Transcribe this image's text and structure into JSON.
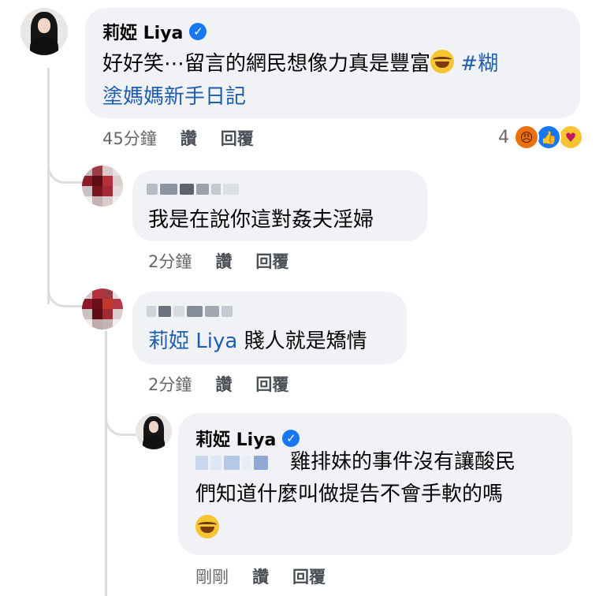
{
  "comments": [
    {
      "author": "莉婭 Liya",
      "verified": true,
      "text_line1": "好好笑⋯留言的網民想像力真是豐富",
      "hashtag_part1": "#糊",
      "text_line2": "塗媽媽新手日記",
      "time": "45分鐘",
      "like_label": "讚",
      "reply_label": "回覆",
      "reaction_count": "4"
    },
    {
      "author_blurred": true,
      "text": "我是在說你這對姦夫淫婦",
      "time": "2分鐘",
      "like_label": "讚",
      "reply_label": "回覆"
    },
    {
      "author_blurred": true,
      "mention": "莉婭 Liya",
      "text": "賤人就是矯情",
      "time": "2分鐘",
      "like_label": "讚",
      "reply_label": "回覆"
    },
    {
      "author": "莉婭 Liya",
      "verified": true,
      "text_line1": "雞排妹的事件沒有讓酸民",
      "text_line2": "們知道什麼叫做提告不會手軟的嗎",
      "time": "剛剛",
      "like_label": "讚",
      "reply_label": "回覆"
    }
  ],
  "icons": {
    "verified": "verified-badge-icon",
    "reaction_angry": "angry-reaction-icon",
    "reaction_like": "like-reaction-icon",
    "reaction_care": "care-reaction-icon",
    "emoji": "laughing-tears-emoji"
  },
  "colors": {
    "bubble": "#f0f2f5",
    "link": "#1d5fae",
    "meta": "#65676b",
    "verified": "#1877f2"
  }
}
